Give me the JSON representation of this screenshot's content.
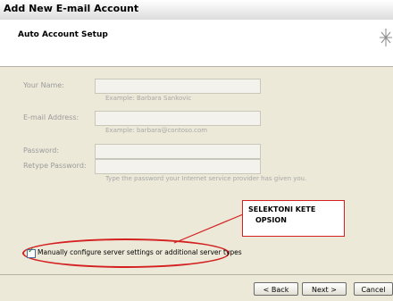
{
  "window": {
    "title": "Add New E-mail Account"
  },
  "header": {
    "title": "Auto Account Setup",
    "icon": "sparkle-icon"
  },
  "form": {
    "name_label": "Your Name:",
    "name_value": "",
    "name_hint": "Example: Barbara Sankovic",
    "email_label": "E-mail Address:",
    "email_value": "",
    "email_hint": "Example: barbara@contoso.com",
    "password_label": "Password:",
    "retype_label": "Retype Password:",
    "password_hint": "Type the password your Internet service provider has given you."
  },
  "callout": {
    "line1": "SELEKTONI KETE",
    "line2": "OPSION"
  },
  "manual_config": {
    "label": "Manually configure server settings or additional server types",
    "checked": true
  },
  "buttons": {
    "back": "< Back",
    "next": "Next >",
    "cancel": "Cancel"
  },
  "colors": {
    "annotation": "#d42020"
  }
}
